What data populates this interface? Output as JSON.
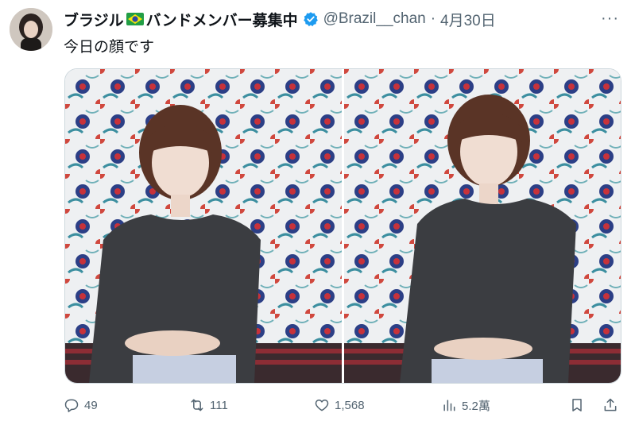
{
  "post": {
    "author_name": "ブラジル",
    "author_name_suffix": "バンドメンバー募集中",
    "flag_icon": "brazil-flag-emoji",
    "verified_icon": "verified-badge-icon",
    "handle": "@Brazil__chan",
    "separator": "·",
    "date": "4月30日",
    "more_icon": "more-options-icon",
    "more_label": "···",
    "text": "今日の顔です"
  },
  "media": {
    "photos": [
      {
        "label": "photo-1"
      },
      {
        "label": "photo-2"
      }
    ]
  },
  "actions": {
    "replies": "49",
    "retweets": "111",
    "likes": "1,568",
    "views": "5.2萬"
  },
  "colors": {
    "text": "#0f1419",
    "muted": "#536471",
    "verified": "#1d9bf0"
  }
}
